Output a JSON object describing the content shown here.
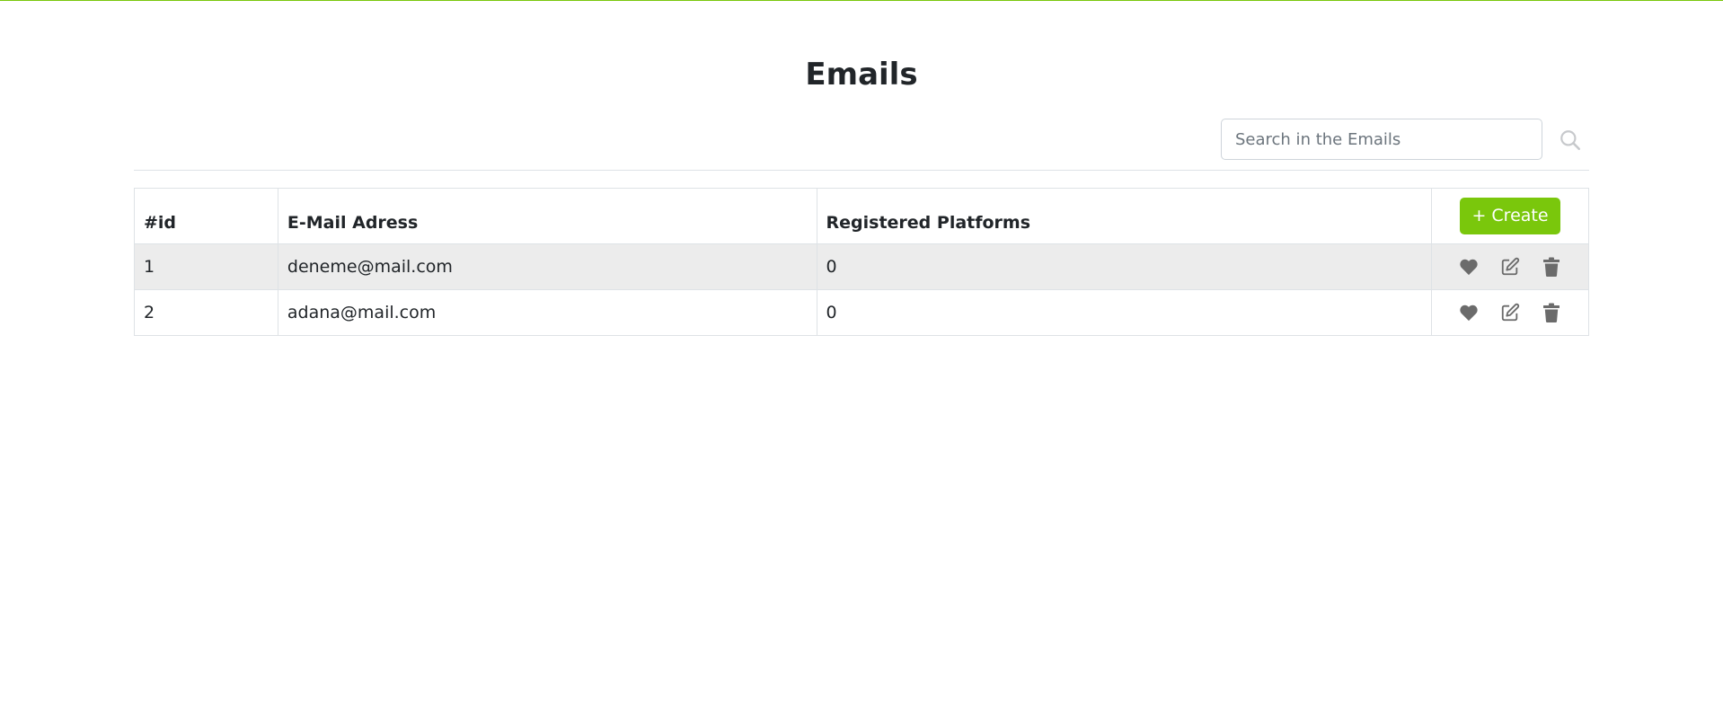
{
  "page": {
    "title": "Emails",
    "accent_color": "#7ac70c"
  },
  "search": {
    "placeholder": "Search in the Emails",
    "value": "",
    "icon": "search-icon"
  },
  "table": {
    "headers": {
      "id": "#id",
      "email": "E-Mail Adress",
      "platforms": "Registered Platforms"
    },
    "create_label": "+ Create",
    "rows": [
      {
        "id": "1",
        "email": "deneme@mail.com",
        "platforms": "0"
      },
      {
        "id": "2",
        "email": "adana@mail.com",
        "platforms": "0"
      }
    ],
    "row_actions": [
      "heart-icon",
      "edit-icon",
      "trash-icon"
    ]
  }
}
